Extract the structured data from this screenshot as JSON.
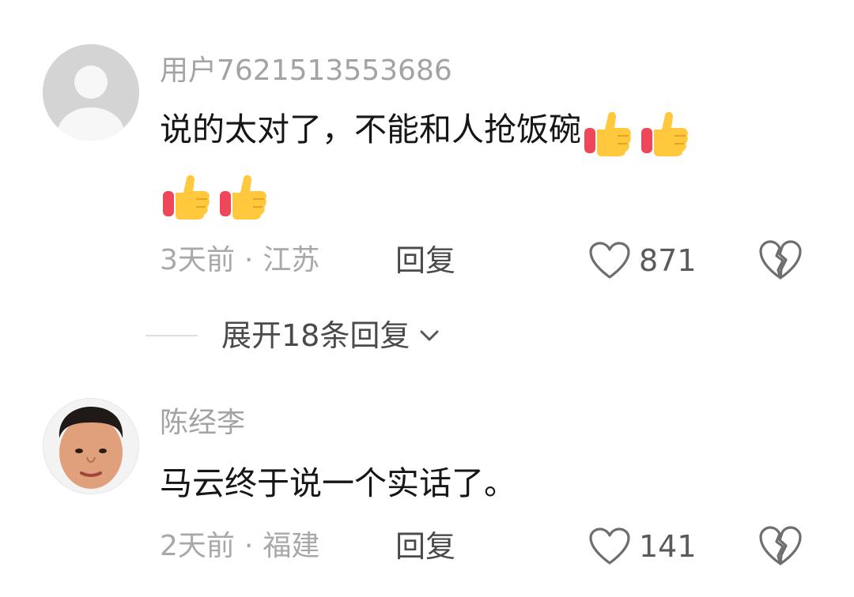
{
  "comments": [
    {
      "username": "用户7621513553686",
      "text": "说的太对了，不能和人抢饭碗",
      "time": "3天前",
      "separator": "·",
      "location": "江苏",
      "reply_label": "回复",
      "like_count": "871",
      "emoji": "thumbs-up",
      "emoji_count": 4
    },
    {
      "username": "陈经李",
      "text": "马云终于说一个实话了。",
      "time": "2天前",
      "separator": "·",
      "location": "福建",
      "reply_label": "回复",
      "like_count": "141"
    }
  ],
  "expand_replies": {
    "label": "展开18条回复"
  }
}
